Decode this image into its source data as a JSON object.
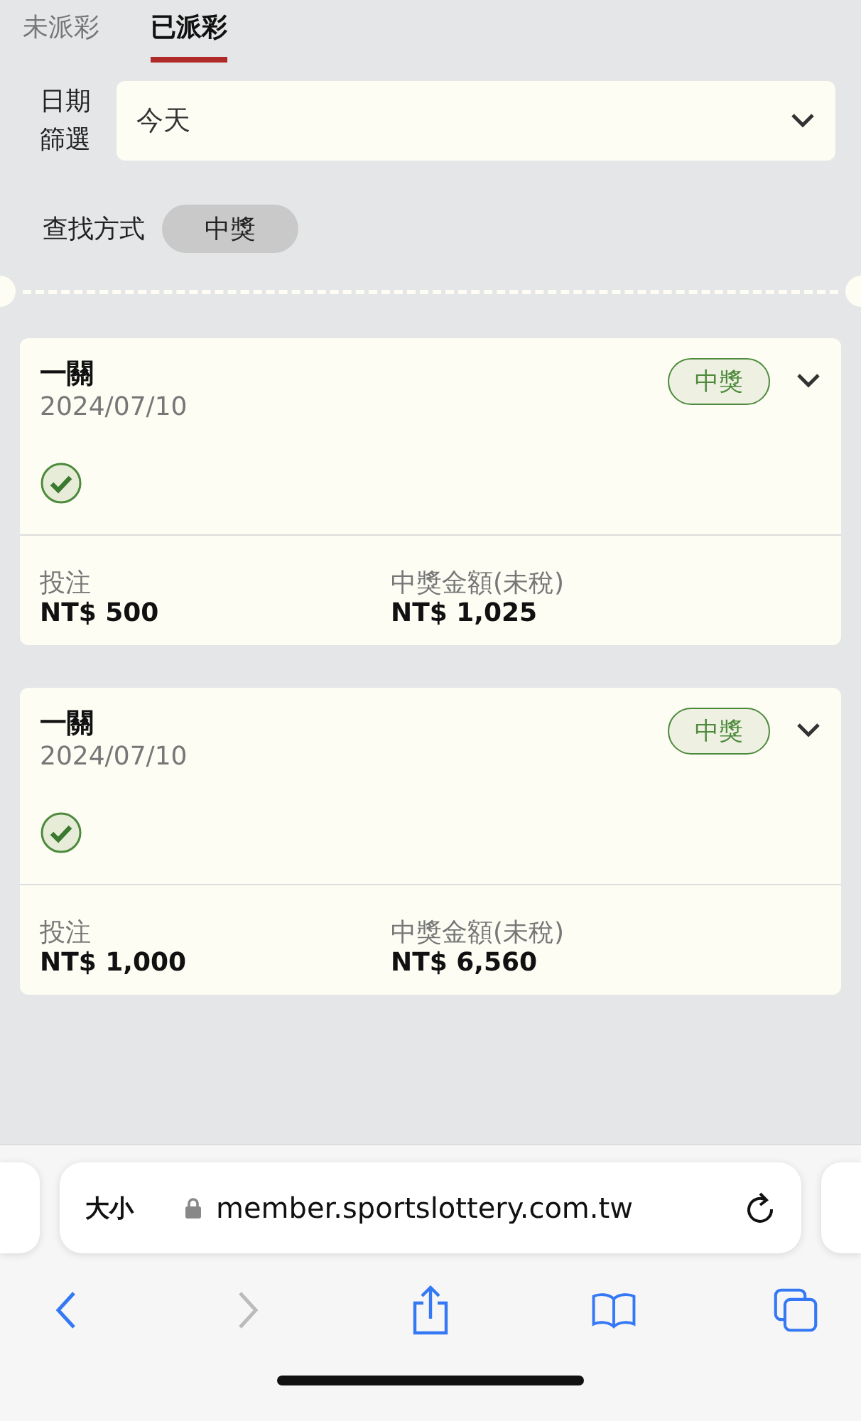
{
  "tabs": [
    {
      "label": "未派彩",
      "selected": false
    },
    {
      "label": "已派彩",
      "selected": true
    }
  ],
  "date_filter": {
    "label": "日期篩選",
    "value": "今天"
  },
  "search_mode": {
    "label": "查找方式",
    "chip": "中獎"
  },
  "bets": [
    {
      "title": "一關",
      "date": "2024/07/10",
      "status": "中獎",
      "checked": true,
      "stake_label": "投注",
      "stake": "NT$ 500",
      "payout_label": "中獎金額(未稅)",
      "payout": "NT$ 1,025"
    },
    {
      "title": "一關",
      "date": "2024/07/10",
      "status": "中獎",
      "checked": true,
      "stake_label": "投注",
      "stake": "NT$ 1,000",
      "payout_label": "中獎金額(未稅)",
      "payout": "NT$ 6,560"
    }
  ],
  "browser": {
    "text_size": "大小",
    "url": "member.sportslottery.com.tw",
    "forward_disabled": true
  }
}
